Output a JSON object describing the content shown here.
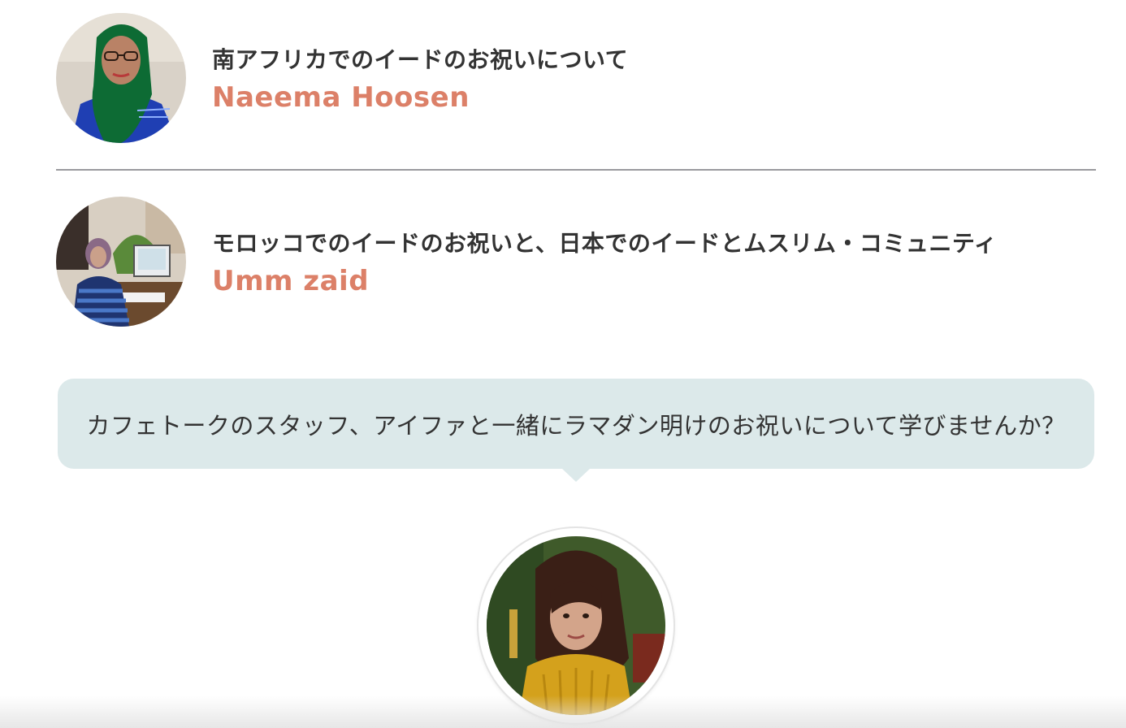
{
  "articles": [
    {
      "title": "南アフリカでのイードのお祝いについて",
      "author": "Naeema Hoosen"
    },
    {
      "title": "モロッコでのイードのお祝いと、日本でのイードとムスリム・コミュニティ",
      "author": "Umm zaid"
    }
  ],
  "promo": {
    "message": "カフェトークのスタッフ、アイファと一緒にラマダン明けのお祝いについて学びませんか？"
  },
  "colors": {
    "author_accent": "#dc8068",
    "bubble_bg": "#dce9ea",
    "title_text": "#333333",
    "divider": "#9a9a9e"
  }
}
